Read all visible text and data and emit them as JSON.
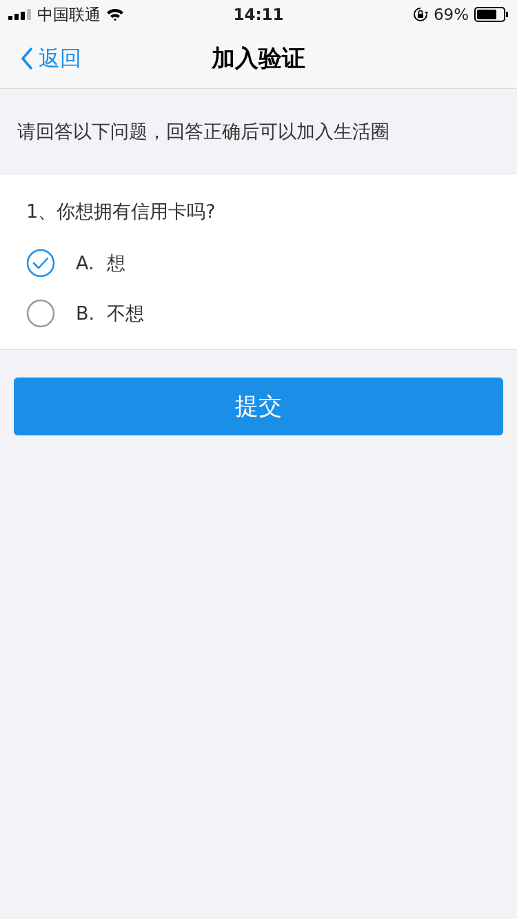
{
  "status_bar": {
    "carrier": "中国联通",
    "time": "14:11",
    "battery": "69%"
  },
  "nav": {
    "back": "返回",
    "title": "加入验证"
  },
  "intro": "请回答以下问题，回答正确后可以加入生活圈",
  "question": {
    "text": "1、你想拥有信用卡吗?",
    "options": [
      {
        "letter": "A.",
        "label": "想",
        "selected": true
      },
      {
        "letter": "B.",
        "label": "不想",
        "selected": false
      }
    ]
  },
  "submit": "提交"
}
